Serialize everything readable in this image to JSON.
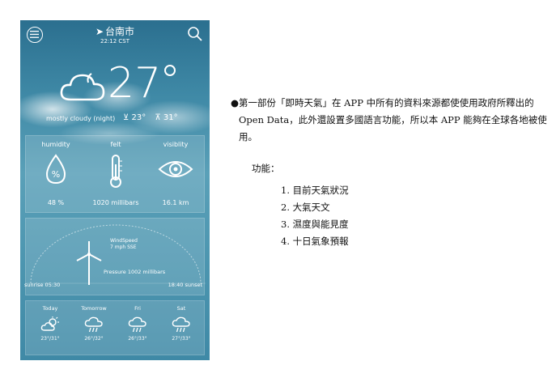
{
  "app": {
    "city": "台南市",
    "time": "22:12 CST",
    "temperature": "27",
    "summary": "mostly cloudy (night)",
    "temp_low": "23°",
    "temp_high": "31°",
    "stats": [
      {
        "label": "humidity",
        "value": "48 %"
      },
      {
        "label": "felt",
        "value": "1020 millibars"
      },
      {
        "label": "visiblity",
        "value": "16.1 km"
      }
    ],
    "wind": {
      "title": "WindSpeed",
      "speed": "7 mph SSE",
      "pressure": "Pressure 1002 millibars",
      "sunrise": "sunrise 05:30",
      "sunset": "18:40 sunset"
    },
    "forecast": [
      {
        "day": "Today",
        "temps": "23°/31°",
        "icon": "partly-cloudy-icon"
      },
      {
        "day": "Tomorrow",
        "temps": "26°/32°",
        "icon": "rain-cloud-icon"
      },
      {
        "day": "Fri",
        "temps": "26°/33°",
        "icon": "rain-cloud-icon"
      },
      {
        "day": "Sat",
        "temps": "27°/33°",
        "icon": "rain-cloud-icon"
      }
    ]
  },
  "doc": {
    "bullet": "●",
    "paragraph": "第一部份「即時天氣」在 APP 中所有的資料來源都使使用政府所釋出的 Open Data，此外還設置多國語言功能，所以本 APP 能夠在全球各地被使用。",
    "features_title": "功能：",
    "features": [
      "1.  目前天氣狀況",
      "2.  大氣天文",
      "3.  濕度與能見度",
      "4.  十日氣象預報"
    ]
  },
  "colors": {
    "sky_top": "#2b6f8f",
    "sky_mid": "#5aa0b8",
    "text_dark": "#111111"
  }
}
